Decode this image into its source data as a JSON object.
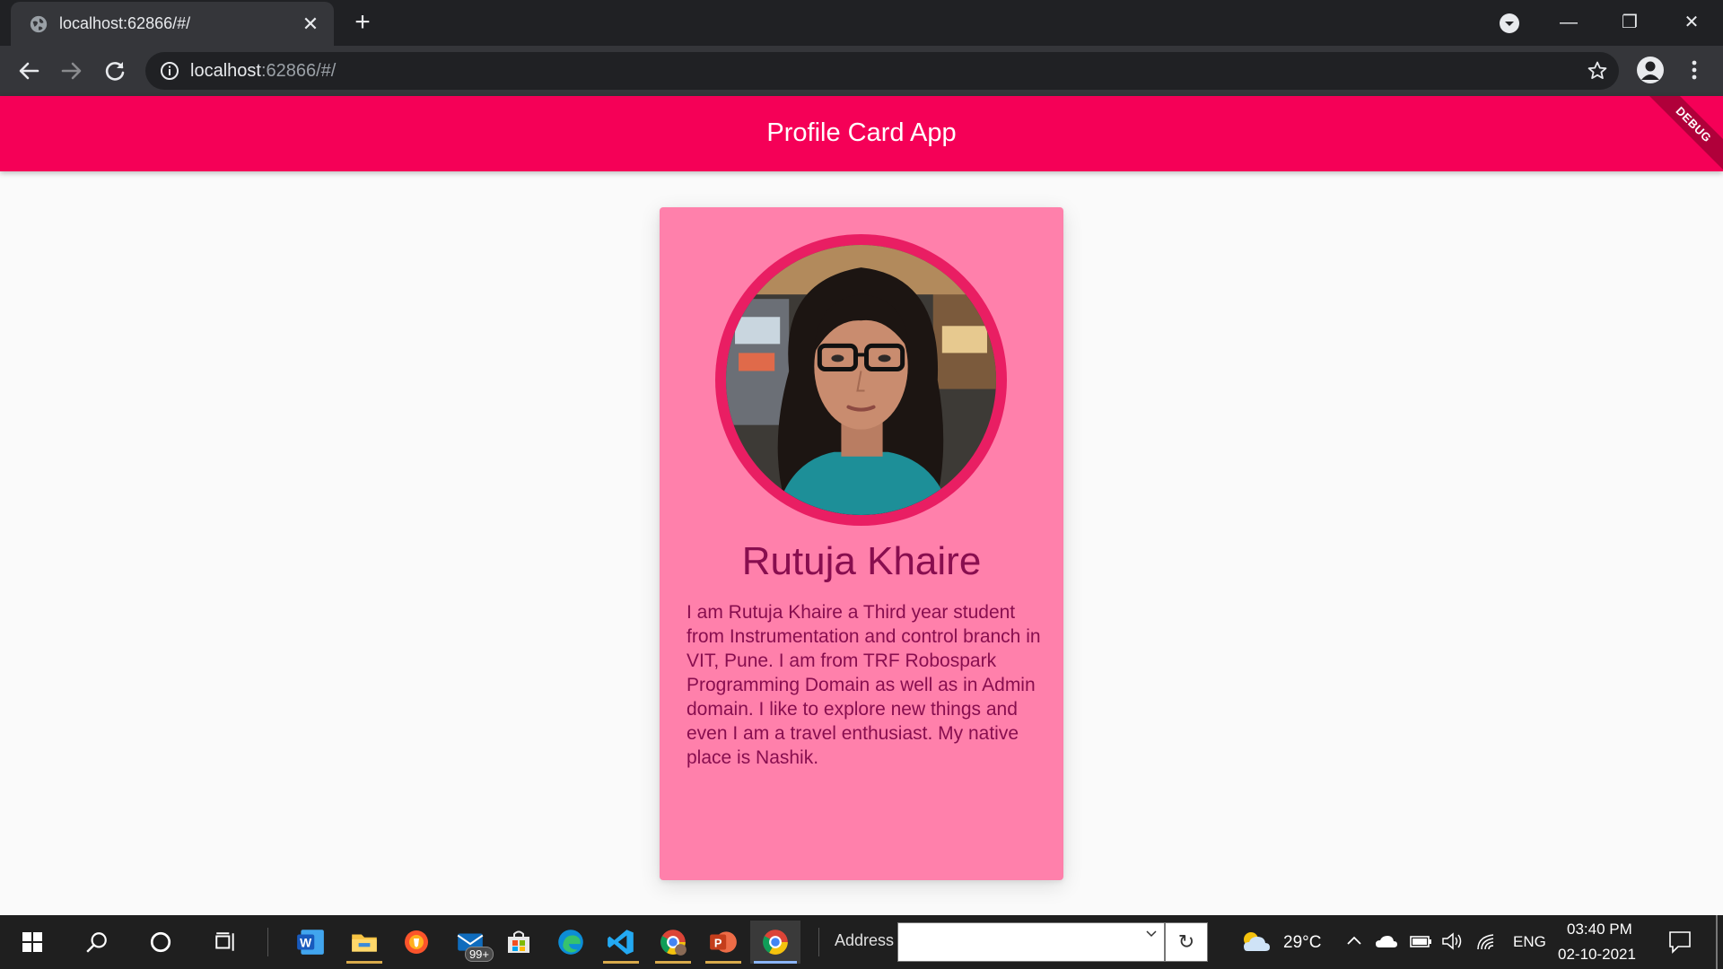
{
  "browser": {
    "tab_title": "localhost:62866/#/",
    "tab_close": "✕",
    "new_tab": "+",
    "url_host": "localhost",
    "url_rest": ":62866/#/",
    "minimize": "—",
    "restore": "❐",
    "close": "✕"
  },
  "app": {
    "title": "Profile Card App",
    "debug_banner": "DEBUG",
    "profile": {
      "name": "Rutuja Khaire",
      "bio": "I am Rutuja Khaire a Third year student from Instrumentation and control branch in VIT, Pune. I am from TRF Robospark Programming Domain as well as in Admin domain. I like to explore new things and even I am a travel enthusiast. My native place is Nashik."
    },
    "colors": {
      "appbar": "#f50057",
      "card": "#ff80ab",
      "ring": "#e91e63",
      "text": "#880e4f"
    }
  },
  "taskbar": {
    "mail_badge": "99+",
    "address_label": "Address",
    "address_value": "",
    "refresh_glyph": "↻",
    "weather": "29°C",
    "language": "ENG",
    "time": "03:40 PM",
    "date": "02-10-2021",
    "icons": [
      "windows-start-icon",
      "search-icon",
      "cortana-icon",
      "task-view-icon",
      "word-icon",
      "file-explorer-icon",
      "brave-icon",
      "mail-icon",
      "store-icon",
      "edge-icon",
      "vscode-icon",
      "chrome-profile-icon",
      "powerpoint-icon",
      "chrome-icon"
    ]
  }
}
